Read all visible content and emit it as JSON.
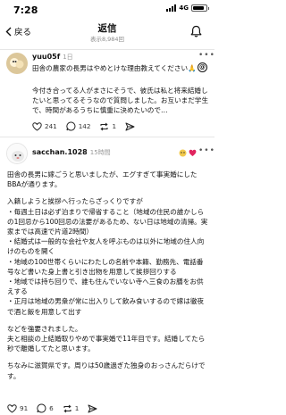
{
  "status_bar": {
    "time": "7:28",
    "network": "4G",
    "battery_level": 0.85
  },
  "nav": {
    "back_label": "戻る",
    "title": "返信",
    "subtitle": "表示8,984回"
  },
  "post1": {
    "username": "yuu05f",
    "time": "1日",
    "text": "田舎の農家の長男はやめとけな理由教えてください🙏",
    "quote": "今付き合ってる人がまさにそうで、彼氏は私と将来結婚したいと思ってるそうなので質問しました。お互いまだ学生で、時間があるうちに慎重に決めたいので…",
    "likes": "241",
    "comments": "142",
    "reposts": "1",
    "avatar_color": "#c9b27a"
  },
  "post2": {
    "username": "sacchan.1028",
    "time": "15時間",
    "lines": [
      "田舎の長男に嫁ごうと思いましたが、エグすぎて事実婚にしたBBAが通ります。",
      "",
      "入籍しようと挨拶へ行ったらざっくりですが",
      "・毎週土日は必ず泊まりで帰省すること（地域の住民の誰かしらの1回忌から100回忌の法要があるため、ない日は地域の清掃。実家までは高速で片道2時間）",
      "・結婚式は一般的な会社や友人を呼ぶものは以外に地域の住人向けのものを開く",
      "・地域の100世帯くらいにわたしの名前や本籍、勤務先、電話番号など書いた身上書と引き出物を用意して挨拶回りする",
      "・地域では持ち回りで、誰も住んでいない寺へ三食のお膳をお供えする",
      "・正月は地域の男衆が常に出入りして飲み食いするので嫁は徹夜で酒と飯を用意して出す",
      "",
      "などを強要されました。",
      "夫と相談の上結婚取りやめで事実婚で11年目です。結婚してたら秒で離婚してたと思います。",
      "",
      "ちなみに滋賀県です。周りは50歳過ぎた独身のおっさんだらけです。"
    ],
    "likes": "91",
    "comments": "6",
    "reposts": "1",
    "avatar_color": "#f2f2f2"
  },
  "colors": {
    "accent": "#111111",
    "muted": "#8a8a8a",
    "badge_red": "#e0245e"
  }
}
